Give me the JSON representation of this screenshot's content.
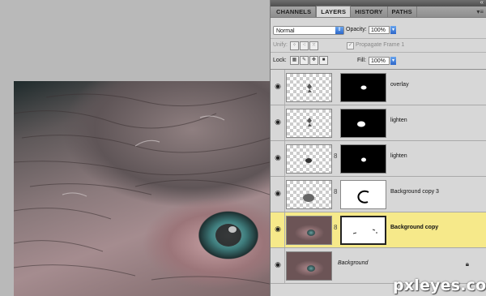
{
  "panel": {
    "tabs": [
      {
        "label": "CHANNELS"
      },
      {
        "label": "LAYERS"
      },
      {
        "label": "HISTORY"
      },
      {
        "label": "PATHS"
      }
    ],
    "menu_icon": "panel-menu-icon",
    "collapse_icon": "double-chevron-icon"
  },
  "options": {
    "blend_mode": "Normal",
    "opacity_label": "Opacity:",
    "opacity_value": "100%",
    "unify_label": "Unify:",
    "propagate_label": "Propagate Frame 1",
    "lock_label": "Lock:",
    "fill_label": "Fill:",
    "fill_value": "100%"
  },
  "layers": [
    {
      "name": "overlay",
      "mask": "black"
    },
    {
      "name": "lighten",
      "mask": "black"
    },
    {
      "name": "lighten",
      "mask": "black"
    },
    {
      "name": "Background copy 3",
      "mask": "white"
    },
    {
      "name": "Background copy",
      "mask": "white",
      "selected": true
    },
    {
      "name": "Background",
      "locked": true
    }
  ],
  "watermark": "pxleyes.com",
  "colors": {
    "selected_layer": "#f6e98a",
    "panel_bg": "#d7d7d7",
    "accent_blue": "#2c66c9"
  }
}
